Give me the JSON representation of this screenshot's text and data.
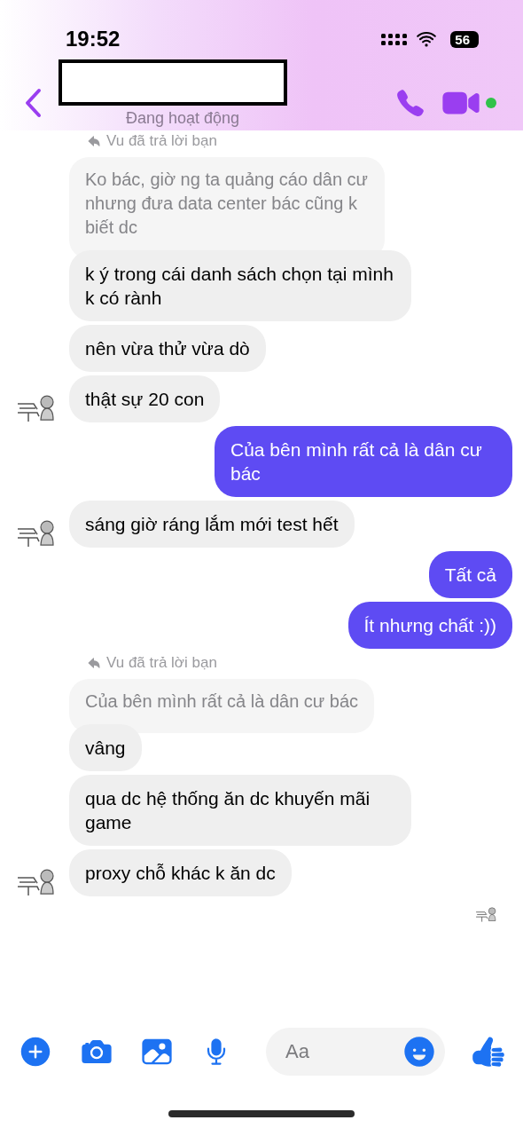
{
  "status_bar": {
    "time": "19:52",
    "battery": "56"
  },
  "header": {
    "status": "Đang hoạt động",
    "online": true
  },
  "messages": [
    {
      "kind": "reply_label",
      "text": "Vu đã trả lời bạn"
    },
    {
      "kind": "quoted",
      "text": "Ko bác, giờ ng ta quảng cáo dân cư nhưng đưa data center bác cũng k biết dc"
    },
    {
      "kind": "incoming",
      "text": "k ý trong cái danh sách chọn tại mình k có rành",
      "avatar": false
    },
    {
      "kind": "incoming",
      "text": "nên vừa thử vừa dò",
      "avatar": false
    },
    {
      "kind": "incoming",
      "text": "thật sự 20 con",
      "avatar": true
    },
    {
      "kind": "outgoing",
      "text": "Của bên mình rất cả là dân cư bác"
    },
    {
      "kind": "incoming",
      "text": "sáng giờ ráng lắm mới test hết",
      "avatar": true
    },
    {
      "kind": "outgoing",
      "text": "Tất cả"
    },
    {
      "kind": "outgoing",
      "text": "Ít nhưng chất :))"
    },
    {
      "kind": "reply_label",
      "text": "Vu đã trả lời bạn"
    },
    {
      "kind": "quoted",
      "text": "Của bên mình rất cả là dân cư bác"
    },
    {
      "kind": "incoming",
      "text": "vâng",
      "avatar": false
    },
    {
      "kind": "incoming",
      "text": "qua dc hệ thống ăn dc khuyến mãi game",
      "avatar": false
    },
    {
      "kind": "incoming",
      "text": "proxy chỗ khác k ăn dc",
      "avatar": true
    }
  ],
  "seen": true,
  "composer": {
    "placeholder": "Aa"
  }
}
